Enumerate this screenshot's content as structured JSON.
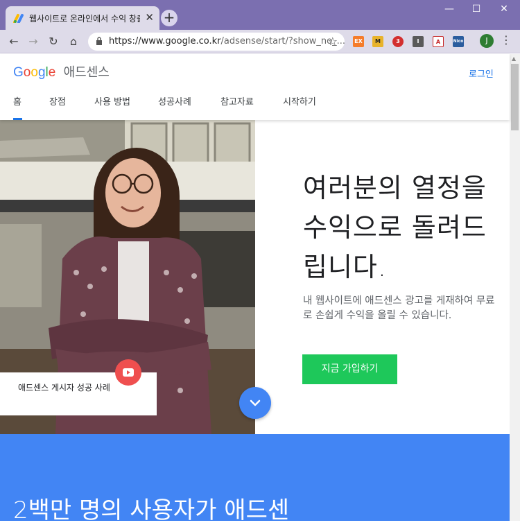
{
  "browser": {
    "tab_title": "웹사이트로 온라인에서 수익 창출",
    "url_main": "https://www.google.co.kr",
    "url_path": "/adsense/start/?show_no_...",
    "profile_initial": "J",
    "extensions": [
      {
        "name": "ex-icon",
        "label": "EX",
        "color": "#f57c2a"
      },
      {
        "name": "m-icon",
        "label": "M",
        "color": "#e8b32b"
      },
      {
        "name": "opera-icon",
        "label": "3",
        "color": "#d32f2f"
      },
      {
        "name": "i-icon",
        "label": "I",
        "color": "#5a5a5a"
      },
      {
        "name": "pdf-icon",
        "label": "A",
        "color": "#c62828"
      },
      {
        "name": "nico-icon",
        "label": "Nico",
        "color": "#2b5d9e"
      }
    ]
  },
  "header": {
    "logo_google": "Google",
    "logo_product": "애드센스",
    "login": "로그인",
    "nav": [
      "홈",
      "장점",
      "사용 방법",
      "성공사례",
      "참고자료",
      "시작하기"
    ]
  },
  "hero": {
    "title": "여러분의 열정을 수익으로 돌려드립니다.",
    "description": "내 웹사이트에 애드센스 광고를 게재하여 무료로 손쉽게 수익을 올릴 수 있습니다.",
    "cta": "지금 가입하기",
    "caption": "애드센스 게시자 성공 사례"
  },
  "section2": {
    "title": "2백만 명의 사용자가 애드센"
  }
}
